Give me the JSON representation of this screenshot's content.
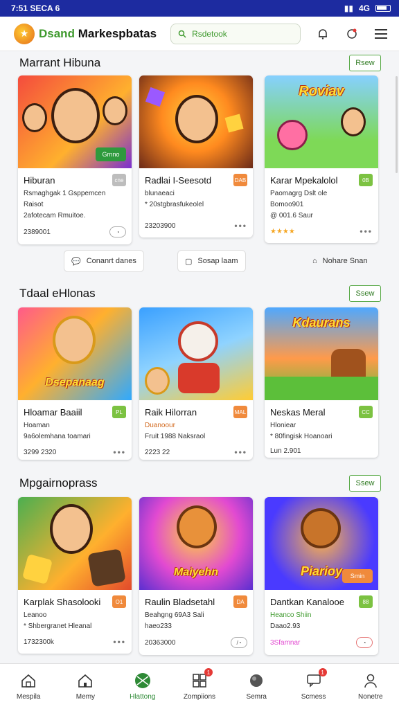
{
  "status": {
    "time": "7:51 SECA 6",
    "right": "4G"
  },
  "header": {
    "brand_part1": "Dsand",
    "brand_part2": "Markespbatas",
    "search_text": "Rsdetook"
  },
  "sections": [
    {
      "title": "Marrant Hibuna",
      "see_label": "Rsew",
      "cards": [
        {
          "title": "Hiburan",
          "line1": "Rsmaghgak 1 Gsppemcen",
          "line2": "Raisot",
          "line3": "2afotecam Rmuitoe.",
          "foot_left": "2389001",
          "tag": "cne",
          "pill": "Grnno",
          "colors": [
            "#f44b3d",
            "#ffb02e"
          ],
          "tag_color": "#bdbdbd"
        },
        {
          "title": "Radlai I-Seesotd",
          "line1": "blunaeaci",
          "line2": "* 20stgbrasfukeolel",
          "foot_left": "23203900",
          "tag": "DAB",
          "colors": [
            "#ff8a1f",
            "#6b2a18"
          ],
          "tag_color": "#f08a3c"
        },
        {
          "title": "Karar Mpekalolol",
          "line1": "Paomagrg Dslt ole",
          "line2": "Bomoo901",
          "line3": "@ 001.6 Saur",
          "foot_left": "",
          "tag": "0B",
          "sticker": "Roviav",
          "colors": [
            "#7ed957",
            "#3aa0ff"
          ],
          "tag_color": "#7cc242"
        }
      ]
    },
    {
      "title": "Tdaal eHlonas",
      "see_label": "Ssew",
      "cards": [
        {
          "title": "Hloamar Baaiil",
          "line1": "Hoaman",
          "line2": "9a6olemhana toamari",
          "line3": "3299 2320",
          "tag": "PL",
          "sticker": "Dsepanaag",
          "colors": [
            "#ff5a8a",
            "#2fa9ff"
          ],
          "tag_color": "#7cc242"
        },
        {
          "title": "Raik Hilorran",
          "line1": "Duanoour",
          "line2": "Fruit 1988 Naksraol",
          "line3": "2223 22",
          "tag": "MAL",
          "colors": [
            "#3aa0ff",
            "#ffcc33"
          ],
          "tag_color": "#f08a3c"
        },
        {
          "title": "Neskas Meral",
          "line1": "Hloniear",
          "line2": "* 80fingisk Hoanoari",
          "line3": "Lun 2.901",
          "tag": "CC",
          "sticker": "Kdaurans",
          "colors": [
            "#ff7a2f",
            "#5cbf3a"
          ],
          "tag_color": "#7cc242"
        }
      ]
    },
    {
      "title": "Mpgairnoprass",
      "see_label": "Ssew",
      "cards": [
        {
          "title": "Karplak Shasolooki",
          "line1": "Leanoo",
          "line2": "* Shbergranet Hleanal",
          "foot_left": "1732300k",
          "tag": "O1",
          "colors": [
            "#4caf50",
            "#ffb02e"
          ],
          "tag_color": "#f08a3c"
        },
        {
          "title": "Raulin Bladsetahl",
          "line1": "Beahgng 69A3 Sali",
          "line2": "haeo233",
          "foot_left": "20363000",
          "tag": "DA",
          "sticker": "Maiyehn",
          "colors": [
            "#e24ad1",
            "#ffb02e"
          ],
          "tag_color": "#f08a3c"
        },
        {
          "title": "Dantkan Kanalooe",
          "line1": "Heanco Shiin",
          "line2": "Daao2.93",
          "foot_left": "3Sfamnar",
          "tag": "88",
          "sticker": "Piarioy",
          "pill": "Smin",
          "colors": [
            "#4a3aff",
            "#ff9a1f"
          ],
          "tag_color": "#7cc242"
        }
      ]
    }
  ],
  "chips": [
    {
      "label": "Conanrt danes",
      "icon": "chat-icon"
    },
    {
      "label": "Sosap laam",
      "icon": "square-icon"
    },
    {
      "label": "Nohare Snan",
      "icon": "house-icon"
    }
  ],
  "nav": [
    {
      "label": "Mespila",
      "icon": "home-icon"
    },
    {
      "label": "Memy",
      "icon": "home-alt-icon"
    },
    {
      "label": "Hlattong",
      "icon": "basketball-icon",
      "active": true
    },
    {
      "label": "Zompiions",
      "icon": "grid-icon",
      "badge": "1"
    },
    {
      "label": "Semra",
      "icon": "ball-icon"
    },
    {
      "label": "Scmess",
      "icon": "message-icon",
      "badge": "1"
    },
    {
      "label": "Nonetre",
      "icon": "person-icon"
    }
  ]
}
